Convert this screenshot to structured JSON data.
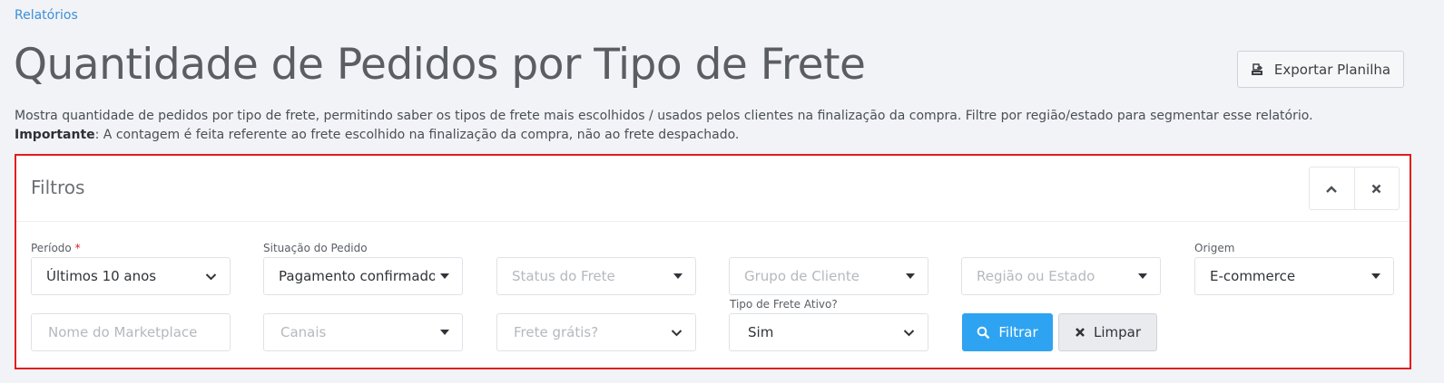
{
  "breadcrumb": "Relatórios",
  "page_title": "Quantidade de Pedidos por Tipo de Frete",
  "export_button": {
    "label": "Exportar Planilha",
    "icon": "export-spreadsheet-icon"
  },
  "description": {
    "line1": "Mostra quantidade de pedidos por tipo de frete, permitindo saber os tipos de frete mais escolhidos / usados pelos clientes na finalização da compra. Filtre por região/estado para segmentar esse relatório.",
    "important_label": "Importante",
    "line2": ": A contagem é feita referente ao frete escolhido na finalização da compra, não ao frete despachado."
  },
  "filters": {
    "title": "Filtros",
    "collapse_icon": "chevron-up-icon",
    "close_icon": "close-icon",
    "periodo": {
      "label": "Período",
      "required_mark": "*",
      "value": "Últimos 10 anos"
    },
    "situacao": {
      "label": "Situação do Pedido",
      "value": "Pagamento confirmado"
    },
    "status_frete": {
      "placeholder": "Status do Frete"
    },
    "grupo_cliente": {
      "placeholder": "Grupo de Cliente"
    },
    "regiao_estado": {
      "placeholder": "Região ou Estado"
    },
    "origem": {
      "label": "Origem",
      "value": "E-commerce"
    },
    "marketplace": {
      "placeholder": "Nome do Marketplace"
    },
    "canais": {
      "placeholder": "Canais"
    },
    "frete_gratis": {
      "placeholder": "Frete grátis?"
    },
    "tipo_frete_ativo": {
      "label": "Tipo de Frete Ativo?",
      "value": "Sim"
    },
    "filter_button": {
      "label": "Filtrar",
      "icon": "search-icon"
    },
    "clear_button": {
      "label": "Limpar",
      "icon": "close-icon"
    }
  },
  "colors": {
    "accent": "#2ea3f2",
    "highlight_border": "#e21b1b",
    "link": "#3e8ed8"
  }
}
